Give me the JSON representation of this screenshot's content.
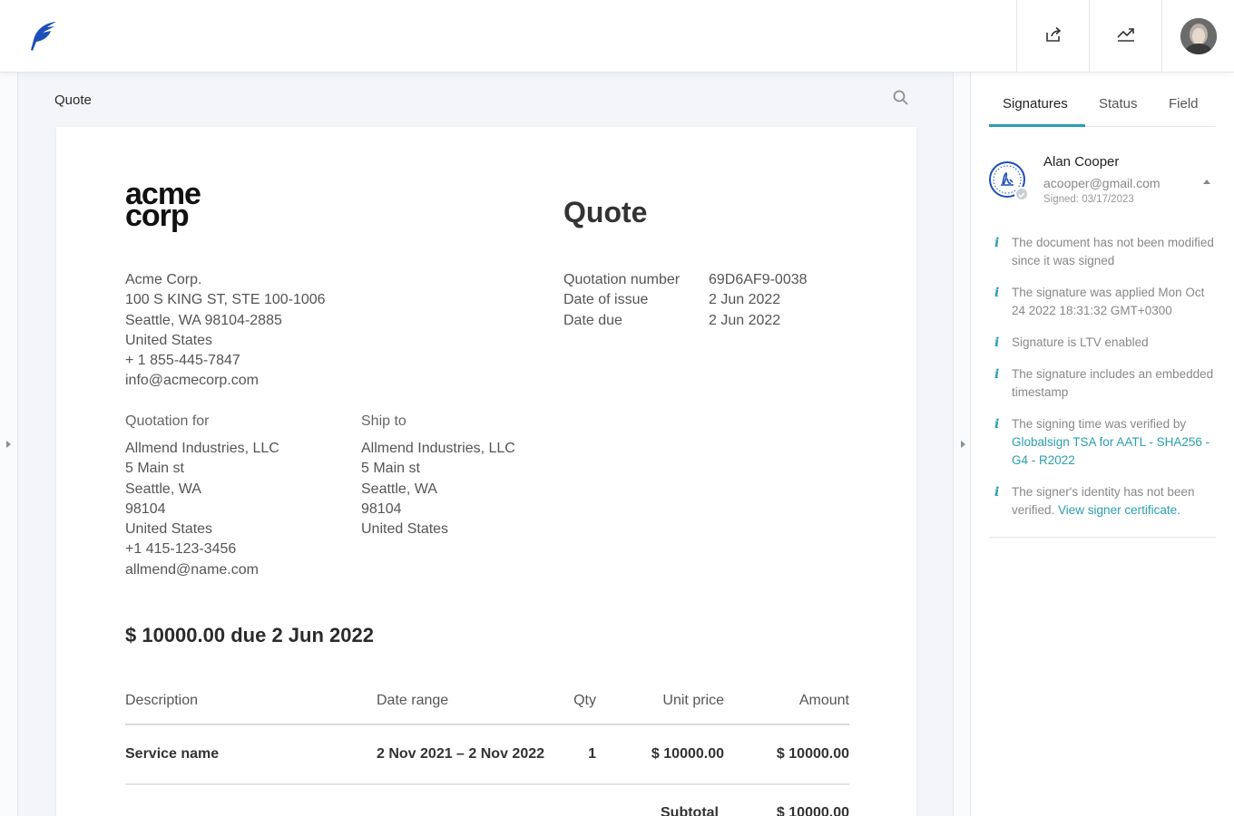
{
  "topbar": {
    "share_icon": "share-export-icon",
    "stats_icon": "trending-chart-icon",
    "accent": "#1d4fb8"
  },
  "viewer": {
    "doc_title": "Quote",
    "search_icon": "search-icon"
  },
  "page": {
    "logo_line1": "acme",
    "logo_line2": "corp",
    "heading": "Quote",
    "from_address": [
      "Acme Corp.",
      "100 S KING ST, STE 100-1006",
      "Seattle, WA 98104-2885",
      "United States",
      "+ 1 855-445-7847",
      "info@acmecorp.com"
    ],
    "meta": [
      {
        "label": "Quotation number",
        "value": "69D6AF9-0038"
      },
      {
        "label": "Date of issue",
        "value": "2 Jun 2022"
      },
      {
        "label": "Date due",
        "value": "2 Jun 2022"
      }
    ],
    "quotation_for_label": "Quotation for",
    "quotation_for": [
      "Allmend Industries, LLC",
      "5 Main st",
      "Seattle, WA",
      "98104",
      "United States",
      "+1 415-123-3456",
      "allmend@name.com"
    ],
    "ship_to_label": "Ship to",
    "ship_to": [
      "Allmend Industries, LLC",
      "5 Main st",
      "Seattle, WA",
      "98104",
      "United States"
    ],
    "due_summary": "$ 10000.00 due 2 Jun 2022",
    "table": {
      "headers": [
        "Description",
        "Date range",
        "Qty",
        "Unit price",
        "Amount"
      ],
      "rows": [
        [
          "Service name",
          "2 Nov 2021 – 2 Nov 2022",
          "1",
          "$ 10000.00",
          "$ 10000.00"
        ]
      ],
      "subtotal_label": "Subtotal",
      "subtotal_value": "$ 10000.00"
    }
  },
  "panel": {
    "tabs": [
      "Signatures",
      "Status",
      "Field"
    ],
    "active_tab": "Signatures",
    "signer": {
      "name": "Alan Cooper",
      "email": "acooper@gmail.com",
      "signed": "Signed: 03/17/2023"
    },
    "checks": [
      {
        "text": "The document has not been modified since it was signed"
      },
      {
        "text": "The signature was applied Mon Oct 24 2022 18:31:32 GMT+0300"
      },
      {
        "text": "Signature is LTV enabled"
      },
      {
        "text": "The signature includes an embedded timestamp"
      },
      {
        "text": "The signing time was verified by ",
        "link": "Globalsign TSA for AATL - SHA256 - G4 - R2022"
      },
      {
        "text": "The signer's identity has not been verified. ",
        "link": "View signer certificate."
      }
    ],
    "accent": "#2a9fb0"
  }
}
